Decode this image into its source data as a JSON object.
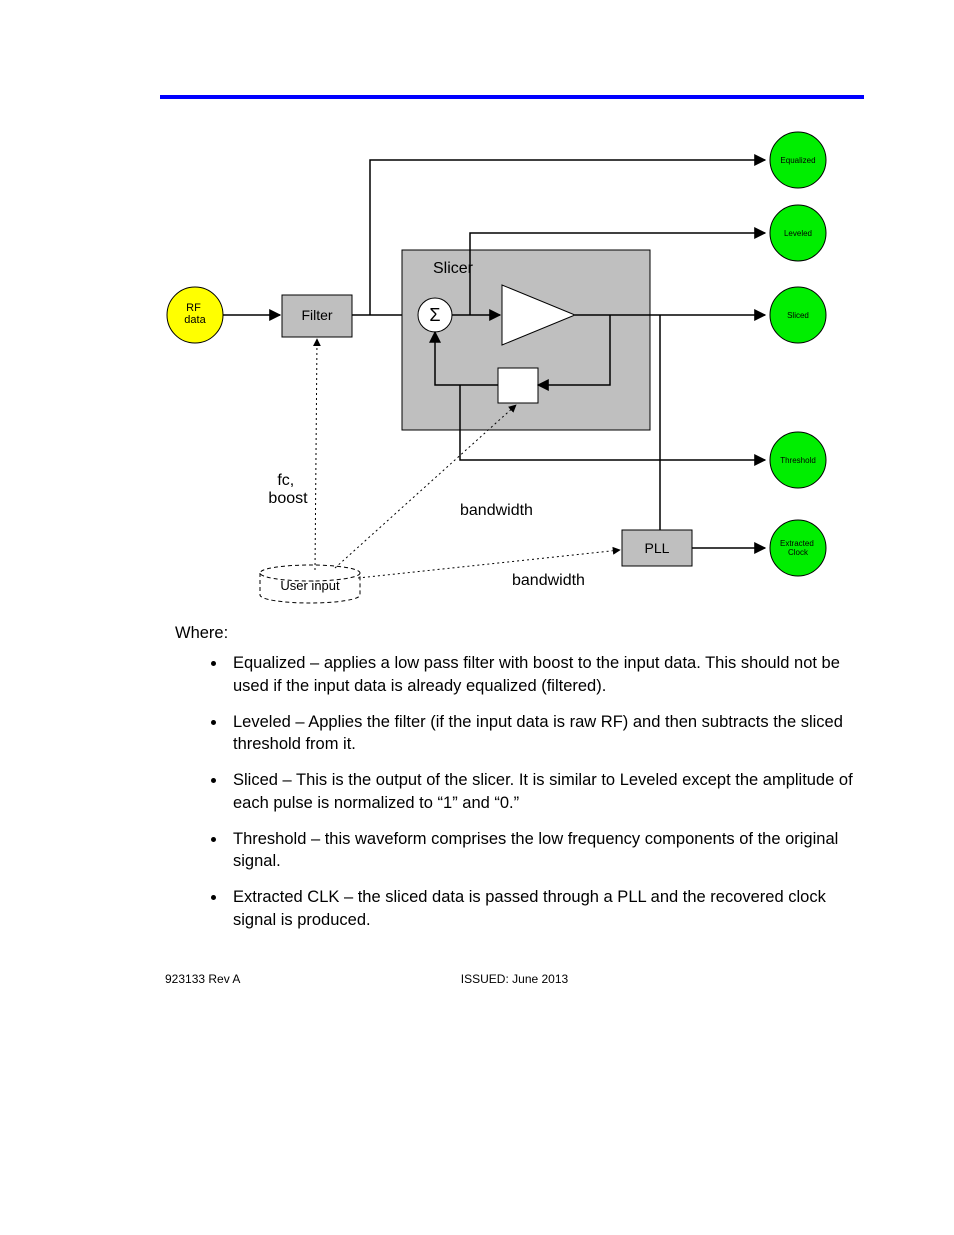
{
  "diagram": {
    "input": {
      "label": "RF\ndata"
    },
    "blocks": {
      "filter": "Filter",
      "slicer": "Slicer",
      "sigma": "Σ",
      "pll": "PLL",
      "userInput": "User input"
    },
    "labels": {
      "fcBoost1": "fc,",
      "fcBoost2": "boost",
      "bandwidth1": "bandwidth",
      "bandwidth2": "bandwidth"
    },
    "outputs": {
      "equalized": "Equalized",
      "leveled": "Leveled",
      "sliced": "Sliced",
      "threshold": "Threshold",
      "extractedClock": "Extracted Clock"
    }
  },
  "text": {
    "whereLabel": "Where:",
    "bullets": {
      "equalized": "Equalized – applies a low pass filter with boost to the input data. This should not be used if the input data is already equalized (filtered).",
      "leveled": "Leveled – Applies the filter (if the input data is raw RF) and then subtracts the sliced threshold from it.",
      "sliced": "Sliced – This is the output of the slicer. It is similar to Leveled except the amplitude of each pulse is normalized to “1” and “0.”",
      "threshold": "Threshold – this waveform comprises the low frequency components of the original signal.",
      "extractedClk": "Extracted CLK – the sliced data is passed through a PLL and the recovered clock signal is produced."
    }
  },
  "footer": {
    "left": "923133 Rev A",
    "center": "ISSUED: June 2013"
  }
}
